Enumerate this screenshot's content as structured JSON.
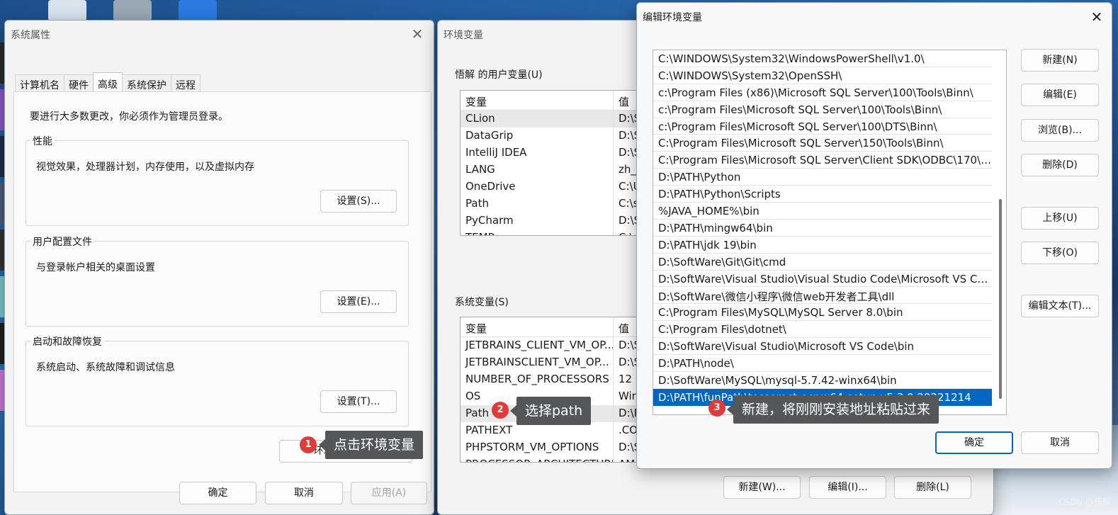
{
  "colors": {
    "accent": "#0067c0",
    "badge": "#e03a3a",
    "callout_bg": "#555658"
  },
  "watermark": "CSDN @悟解",
  "sys_props": {
    "title": "系统属性",
    "tabs": [
      "计算机名",
      "硬件",
      "高级",
      "系统保护",
      "远程"
    ],
    "active_tab": "高级",
    "admin_notice": "要进行大多数更改，你必须作为管理员登录。",
    "performance": {
      "title": "性能",
      "desc": "视觉效果，处理器计划，内存使用，以及虚拟内存",
      "button": "设置(S)..."
    },
    "user_profiles": {
      "title": "用户配置文件",
      "desc": "与登录帐户相关的桌面设置",
      "button": "设置(E)..."
    },
    "startup": {
      "title": "启动和故障恢复",
      "desc": "系统启动、系统故障和调试信息",
      "button": "设置(T)..."
    },
    "env_button": "环境变量(N)...",
    "ok": "确定",
    "cancel": "取消",
    "apply": "应用(A)"
  },
  "env_vars": {
    "title": "环境变量",
    "user_section": "悟解 的用户变量(U)",
    "user_headers": [
      "变量",
      "值"
    ],
    "user_rows": [
      [
        "CLion",
        "D:\\S"
      ],
      [
        "DataGrip",
        "D:\\S"
      ],
      [
        "IntelliJ IDEA",
        "D:\\S"
      ],
      [
        "LANG",
        "zh_C"
      ],
      [
        "OneDrive",
        "C:\\U"
      ],
      [
        "Path",
        "C:\\s"
      ],
      [
        "PyCharm",
        "D:\\S"
      ],
      [
        "TEMP",
        "C:\\"
      ]
    ],
    "system_section": "系统变量(S)",
    "system_headers": [
      "变量",
      "值"
    ],
    "system_rows": [
      [
        "JETBRAINS_CLIENT_VM_OP...",
        "D:\\S"
      ],
      [
        "JETBRAINSCLIENT_VM_OP...",
        "D:\\S"
      ],
      [
        "NUMBER_OF_PROCESSORS",
        "12"
      ],
      [
        "OS",
        "Win"
      ],
      [
        "Path",
        "D:\\F"
      ],
      [
        "PATHEXT",
        ".CO"
      ],
      [
        "PHPSTORM_VM_OPTIONS",
        "D:\\S"
      ],
      [
        "PROCESSOR_ARCHITECTURE",
        "AM"
      ]
    ],
    "new_button": "新建(W)...",
    "edit_button": "编辑(I)...",
    "delete_button": "删除(L)"
  },
  "edit_path": {
    "title": "编辑环境变量",
    "entries": [
      "C:\\WINDOWS\\System32\\WindowsPowerShell\\v1.0\\",
      "C:\\WINDOWS\\System32\\OpenSSH\\",
      "c:\\Program Files (x86)\\Microsoft SQL Server\\100\\Tools\\Binn\\",
      "c:\\Program Files\\Microsoft SQL Server\\100\\Tools\\Binn\\",
      "c:\\Program Files\\Microsoft SQL Server\\100\\DTS\\Binn\\",
      "C:\\Program Files\\Microsoft SQL Server\\150\\Tools\\Binn\\",
      "C:\\Program Files\\Microsoft SQL Server\\Client SDK\\ODBC\\170\\T...",
      "D:\\PATH\\Python",
      "D:\\PATH\\Python\\Scripts",
      "%JAVA_HOME%\\bin",
      "D:\\PATH\\mingw64\\bin",
      "D:\\PATH\\jdk 19\\bin",
      "D:\\SoftWare\\Git\\Git\\cmd",
      "D:\\SoftWare\\Visual Studio\\Visual Studio Code\\Microsoft VS Co...",
      "D:\\SoftWare\\微信小程序\\微信web开发者工具\\dll",
      "C:\\Program Files\\MySQL\\MySQL Server 8.0\\bin",
      "C:\\Program Files\\dotnet\\",
      "D:\\SoftWare\\Visual Studio\\Microsoft VS Code\\bin",
      "D:\\PATH\\node\\",
      "D:\\SoftWare\\MySQL\\mysql-5.7.42-winx64\\bin",
      "D:\\PATH\\funPath\\tesseract-ocr-w64-setup-v5.3.0.20221214"
    ],
    "selected_index": 20,
    "buttons": {
      "new": "新建(N)",
      "edit": "编辑(E)",
      "browse": "浏览(B)...",
      "delete": "删除(D)",
      "move_up": "上移(U)",
      "move_down": "下移(O)",
      "edit_text": "编辑文本(T)..."
    },
    "ok": "确定",
    "cancel": "取消"
  },
  "annotations": [
    {
      "number": "1",
      "text": "点击环境变量"
    },
    {
      "number": "2",
      "text": "选择path"
    },
    {
      "number": "3",
      "text": "新建，将刚刚安装地址粘贴过来"
    }
  ]
}
